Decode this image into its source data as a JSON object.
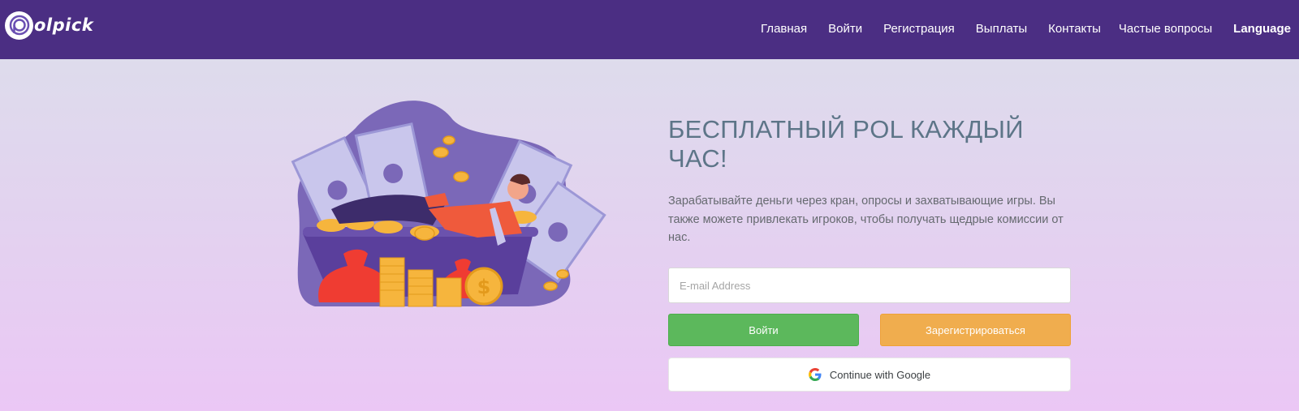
{
  "header": {
    "logo_text": "olpick",
    "nav": [
      {
        "label": "Главная"
      },
      {
        "label": "Войти"
      },
      {
        "label": "Регистрация"
      },
      {
        "label": "Выплаты"
      },
      {
        "label": "Контакты"
      },
      {
        "label": "Частые вопросы"
      },
      {
        "label": "Language"
      }
    ]
  },
  "hero": {
    "title": "БЕСПЛАТНЫЙ POL КАЖДЫЙ ЧАС!",
    "description": "Зарабатывайте деньги через кран, опросы и захватывающие игры. Вы также можете привлекать игроков, чтобы получать щедрые комиссии от нас."
  },
  "form": {
    "email_placeholder": "E-mail Address",
    "email_value": "",
    "login_label": "Войти",
    "register_label": "Зарегистрироваться",
    "google_label": "Continue with Google"
  },
  "colors": {
    "navbar": "#4b2e83",
    "login_button": "#5cb85c",
    "register_button": "#f0ad4e",
    "title": "#5d7588",
    "illustration_blob": "#7b68b8"
  },
  "icons": {
    "logo": "polpick-logo-icon",
    "google": "google-icon"
  }
}
